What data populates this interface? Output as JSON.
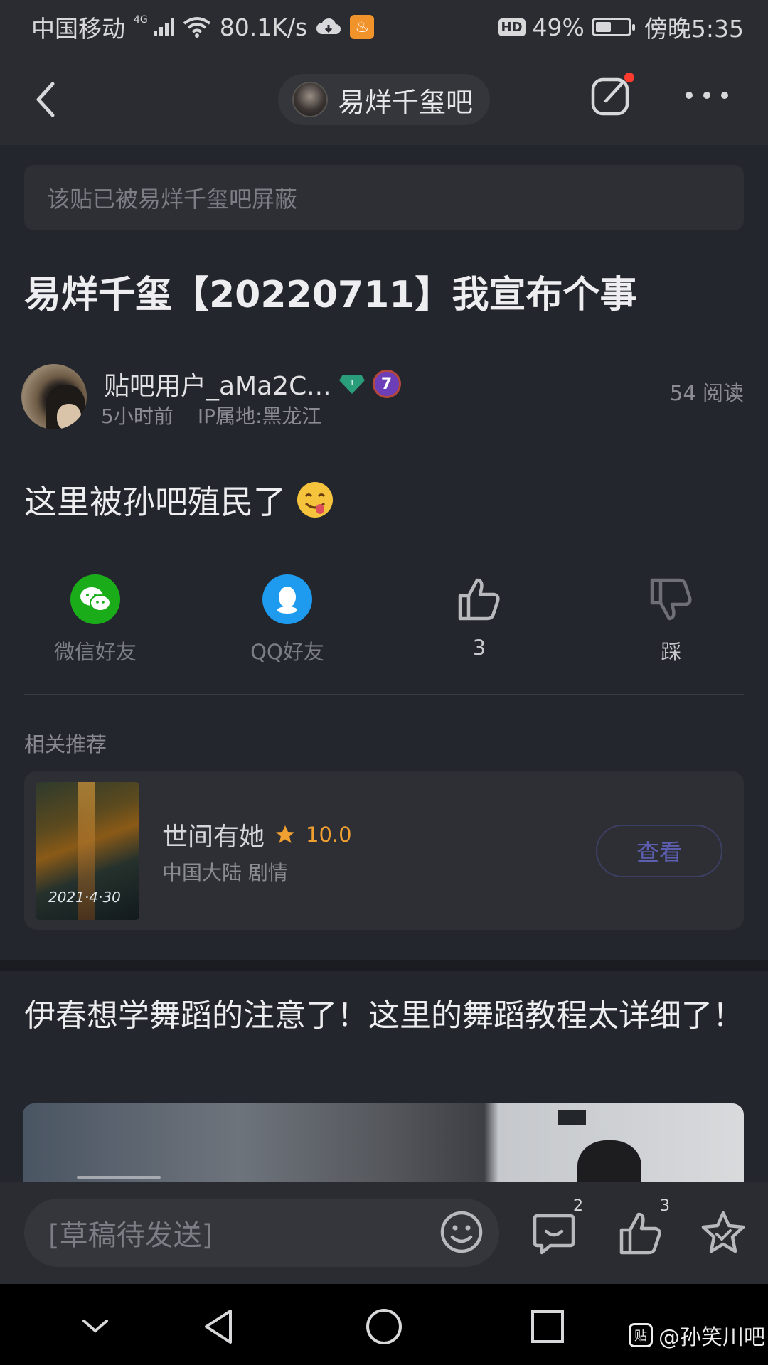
{
  "status_bar": {
    "carrier": "中国移动",
    "network_type": "4G",
    "speed": "80.1K/s",
    "hd": "HD",
    "battery": "49%",
    "battery_level": 0.49,
    "time": "傍晚5:35"
  },
  "nav": {
    "forum_name": "易烊千玺吧"
  },
  "post": {
    "notice": "该贴已被易烊千玺吧屏蔽",
    "title": "易烊千玺【20220711】我宣布个事",
    "author": "贴吧用户_aMa2C...",
    "author_gem_level": "1",
    "author_level": "7",
    "time_ago": "5小时前",
    "ip_location": "IP属地:黑龙江",
    "reads": "54 阅读",
    "body": "这里被孙吧殖民了"
  },
  "actions": {
    "wechat_label": "微信好友",
    "qq_label": "QQ好友",
    "like_count": "3",
    "dislike_label": "踩",
    "colors": {
      "wechat": "#1aad19",
      "qq": "#1e9bef"
    }
  },
  "recommend": {
    "section_title": "相关推荐",
    "title": "世间有她",
    "score": "10.0",
    "subtitle": "中国大陆 剧情",
    "button_label": "查看",
    "poster_date": "2021·4·30"
  },
  "next_post": {
    "title": "伊春想学舞蹈的注意了！这里的舞蹈教程太详细了！"
  },
  "composer": {
    "placeholder": "[草稿待发送]",
    "comment_count": "2",
    "like_count": "3"
  },
  "watermark": {
    "logo_text": "贴",
    "text": "@孙笑川吧"
  }
}
